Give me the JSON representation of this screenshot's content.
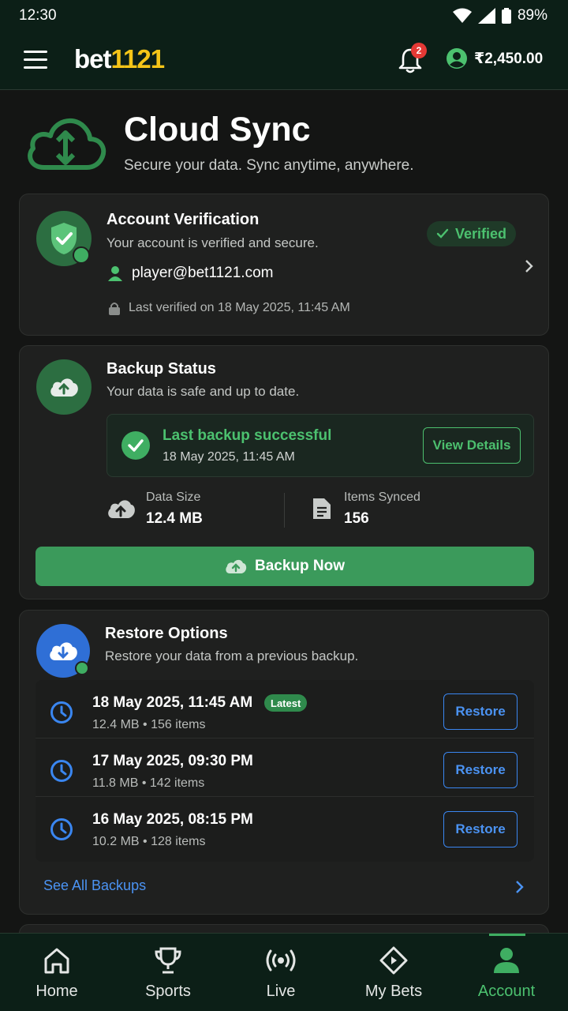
{
  "status_bar": {
    "time": "12:30",
    "battery": "89%"
  },
  "header": {
    "logo_part1": "bet",
    "logo_part2": "1121",
    "notification_count": "2",
    "balance": "₹2,450.00"
  },
  "hero": {
    "title": "Cloud Sync",
    "subtitle": "Secure your data. Sync anytime, anywhere."
  },
  "verification": {
    "title": "Account Verification",
    "subtitle": "Your account is verified and secure.",
    "badge": "Verified",
    "email": "player@bet1121.com",
    "last_verified": "Last verified on 18 May 2025, 11:45 AM"
  },
  "backup": {
    "title": "Backup Status",
    "subtitle": "Your data is safe and up to date.",
    "success_title": "Last backup successful",
    "success_time": "18 May 2025, 11:45 AM",
    "view_details": "View Details",
    "data_size_label": "Data Size",
    "data_size_value": "12.4 MB",
    "items_label": "Items Synced",
    "items_value": "156",
    "backup_now": "Backup Now"
  },
  "restore": {
    "title": "Restore Options",
    "subtitle": "Restore your data from a previous backup.",
    "latest_label": "Latest",
    "restore_label": "Restore",
    "see_all": "See All Backups",
    "items": [
      {
        "date": "18 May 2025, 11:45 AM",
        "meta": "12.4 MB • 156 items"
      },
      {
        "date": "17 May 2025, 09:30 PM",
        "meta": "11.8 MB • 142 items"
      },
      {
        "date": "16 May 2025, 08:15 PM",
        "meta": "10.2 MB • 128 items"
      }
    ]
  },
  "nav": {
    "items": [
      {
        "label": "Home",
        "icon": "home-icon"
      },
      {
        "label": "Sports",
        "icon": "trophy-icon"
      },
      {
        "label": "Live",
        "icon": "live-icon"
      },
      {
        "label": "My Bets",
        "icon": "ticket-icon"
      },
      {
        "label": "Account",
        "icon": "account-icon"
      }
    ],
    "active": "Account"
  },
  "colors": {
    "accent_green": "#4cc16f",
    "button_green": "#3b9a5b",
    "accent_blue": "#3a86f0",
    "brand_yellow": "#f5c518",
    "header_bg": "#0c1f17"
  }
}
